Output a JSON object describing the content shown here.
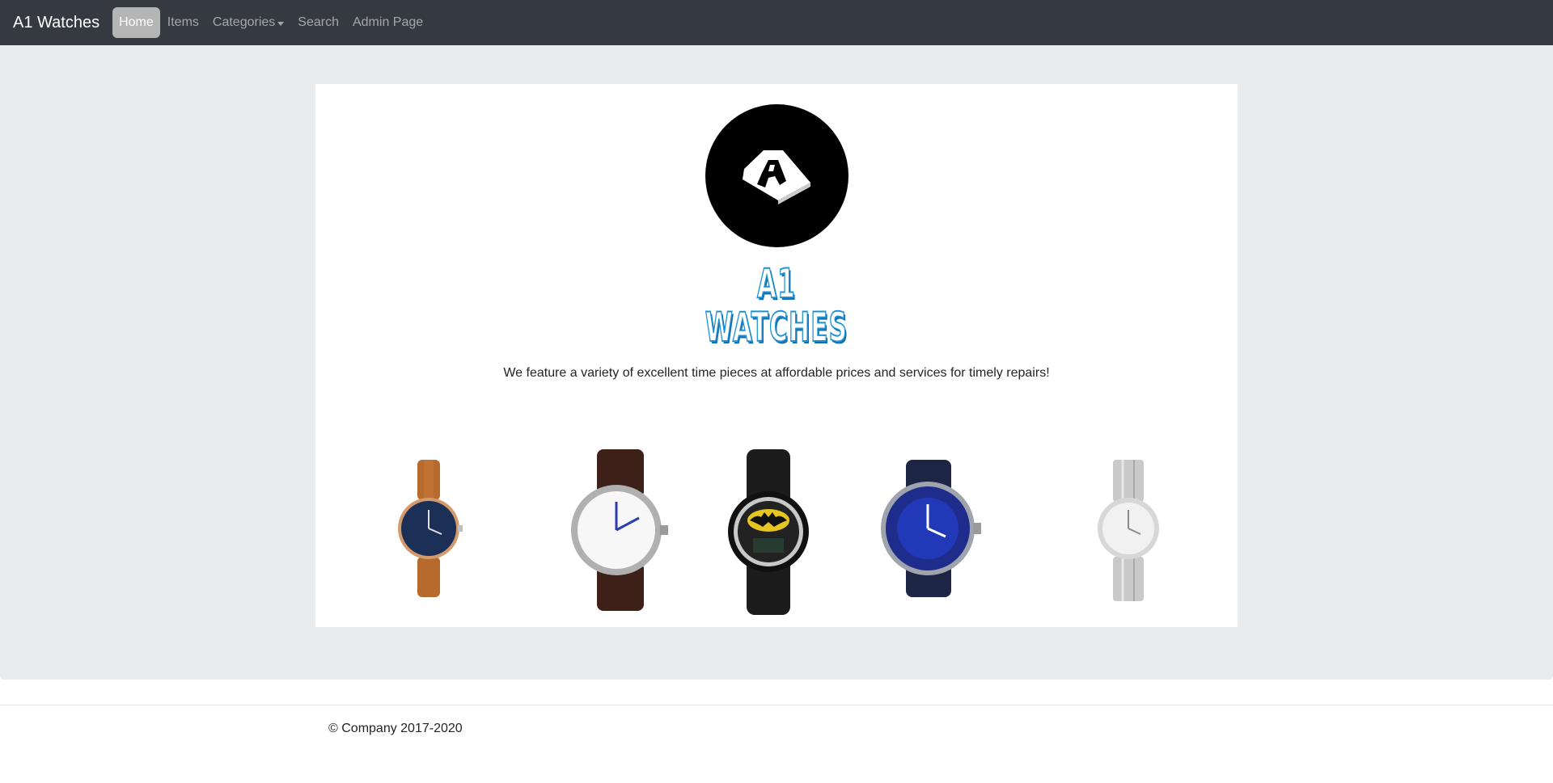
{
  "nav": {
    "brand": "A1 Watches",
    "items": [
      {
        "label": "Home",
        "active": true
      },
      {
        "label": "Items"
      },
      {
        "label": "Categories"
      },
      {
        "label": "Search"
      },
      {
        "label": "Admin Page"
      }
    ]
  },
  "hero": {
    "logo_line1": "A1",
    "logo_line2": "WATCHES",
    "tagline": "We feature a variety of excellent time pieces at affordable prices and services for timely repairs!"
  },
  "watches": [
    {
      "name": "brown-leather-watch"
    },
    {
      "name": "dark-brown-leather-watch"
    },
    {
      "name": "batman-watch"
    },
    {
      "name": "blue-diver-watch"
    },
    {
      "name": "silver-bracelet-watch"
    }
  ],
  "footer": {
    "copyright": "© Company 2017-2020"
  },
  "colors": {
    "navbar": "#343a40",
    "jumbotron": "#e9ecef",
    "logo_blue": "#1a93d6"
  }
}
